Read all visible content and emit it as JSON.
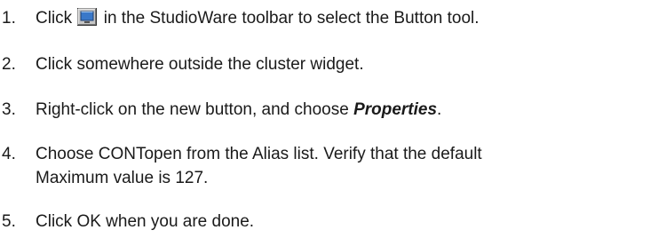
{
  "steps": [
    {
      "number": "1.",
      "text_before": "Click",
      "icon": "button-tool-icon",
      "text_after": "in the StudioWare toolbar to select the Button tool."
    },
    {
      "number": "2.",
      "text": "Click somewhere outside the cluster widget."
    },
    {
      "number": "3.",
      "text_before": "Right-click on the new button, and choose ",
      "emphasis": "Properties",
      "text_after": "."
    },
    {
      "number": "4.",
      "line1": "Choose CONTopen from the Alias list. Verify that the default",
      "line2": "Maximum value is 127."
    },
    {
      "number": "5.",
      "text": "Click OK when you are done."
    }
  ],
  "colors": {
    "text": "#1a1a1a",
    "icon_face": "#c6c6c6",
    "icon_screen": "#3a78c9"
  }
}
